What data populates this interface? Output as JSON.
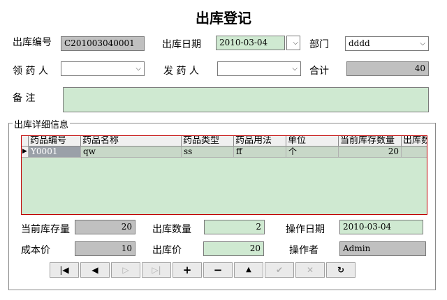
{
  "title": "出库登记",
  "form": {
    "out_no_label": "出库编号",
    "out_no_value": "C201003040001",
    "date_label": "出库日期",
    "date_value": "2010-03-04",
    "dept_label": "部门",
    "dept_value": "dddd",
    "receiver_label": "领 药 人",
    "receiver_value": "",
    "sender_label": "发 药 人",
    "sender_value": "",
    "total_label": "合计",
    "total_value": "40",
    "remark_label": "备  注",
    "remark_value": ""
  },
  "detail": {
    "group_label": "出库详细信息",
    "columns": [
      "药品编号",
      "药品名称",
      "药品类型",
      "药品用法",
      "单位",
      "当前库存数量",
      "出库数"
    ],
    "rows": [
      [
        "Y0001",
        "qw",
        "ss",
        "ff",
        "个",
        "20",
        ""
      ]
    ]
  },
  "bottom": {
    "stock_label": "当前库存量",
    "stock_value": "20",
    "qty_label": "出库数量",
    "qty_value": "2",
    "op_date_label": "操作日期",
    "op_date_value": "2010-03-04",
    "cost_label": "成本价",
    "cost_value": "10",
    "price_label": "出库价",
    "price_value": "20",
    "operator_label": "操作者",
    "operator_value": "Admin"
  },
  "nav": {
    "first": "|◀",
    "prev": "◀",
    "next": "▷",
    "last": "▷|",
    "add": "+",
    "delete": "−",
    "edit": "▲",
    "post": "✔",
    "cancel": "✕",
    "refresh": "↻"
  },
  "colors": {
    "green_field": "#cfe9d1",
    "gray_field": "#c0c0c0",
    "grid_border": "#c00000"
  }
}
